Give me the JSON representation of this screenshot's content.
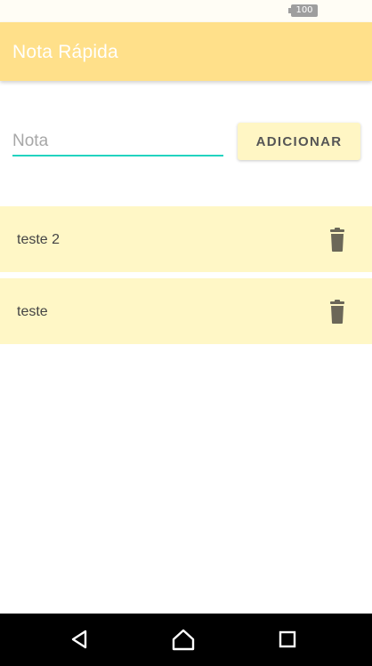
{
  "status_bar": {
    "battery_level": "100"
  },
  "app_bar": {
    "title": "Nota Rápida",
    "color": "#ffe08a"
  },
  "form": {
    "input_value": "",
    "input_placeholder": "Nota",
    "add_button_label": "ADICIONAR",
    "accent_color": "#22d3c0"
  },
  "notes": [
    {
      "text": "teste 2",
      "action_icon": "trash-icon"
    },
    {
      "text": "teste",
      "action_icon": "trash-icon"
    }
  ],
  "nav_bar": {
    "buttons": [
      "back-icon",
      "home-icon",
      "recents-icon"
    ]
  }
}
